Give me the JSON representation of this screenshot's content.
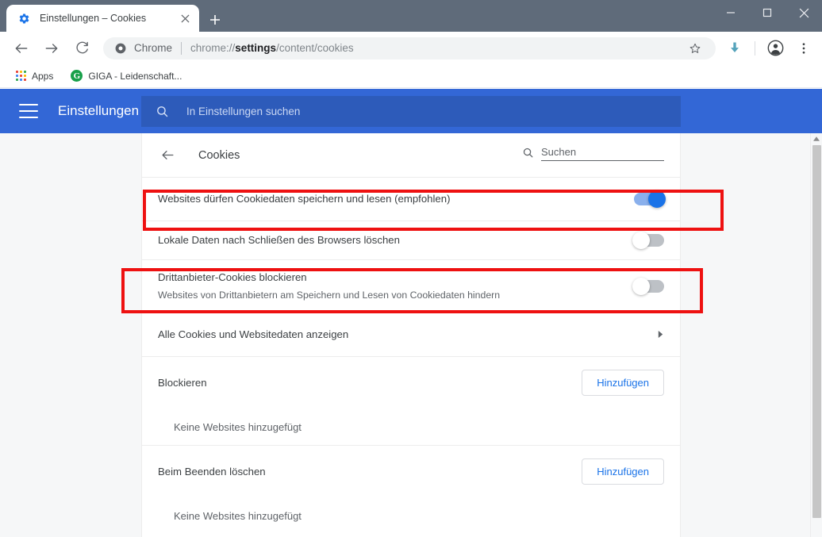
{
  "browser": {
    "tab": {
      "title": "Einstellungen – Cookies",
      "favicon": "gear-icon",
      "close_label": "✕"
    },
    "new_tab_label": "+",
    "window_controls": {
      "minimize": "–",
      "maximize": "☐",
      "close": "✕"
    },
    "toolbar": {
      "back_label": "←",
      "forward_label": "→",
      "reload_label": "⟳",
      "omnibox": {
        "scheme_label": "Chrome",
        "url_prefix": "chrome://",
        "url_bold": "settings",
        "url_suffix": "/content/cookies",
        "star_icon": "star-icon"
      },
      "download_icon": "download-arrow-icon",
      "profile_icon": "profile-avatar-icon",
      "menu_icon": "three-dot-menu-icon"
    },
    "bookmarks": [
      {
        "label": "Apps",
        "icon": "apps-grid-icon"
      },
      {
        "label": "GIGA - Leidenschaft...",
        "icon": "giga-favicon",
        "favicon_letter": "G"
      }
    ]
  },
  "settings_header": {
    "menu_icon": "hamburger-menu-icon",
    "title": "Einstellungen",
    "search": {
      "icon": "search-icon",
      "placeholder": "In Einstellungen suchen",
      "value": ""
    }
  },
  "subpage": {
    "back_icon": "back-arrow-icon",
    "title": "Cookies",
    "search": {
      "icon": "search-icon",
      "placeholder": "Suchen",
      "value": ""
    }
  },
  "rows": [
    {
      "label": "Websites dürfen Cookiedaten speichern und lesen (empfohlen)",
      "sublabel": "",
      "control": "toggle",
      "state": "on",
      "highlighted": true
    },
    {
      "label": "Lokale Daten nach Schließen des Browsers löschen",
      "sublabel": "",
      "control": "toggle",
      "state": "off",
      "highlighted": false
    },
    {
      "label": "Drittanbieter-Cookies blockieren",
      "sublabel": "Websites von Drittanbietern am Speichern und Lesen von Cookiedaten hindern",
      "control": "toggle",
      "state": "off",
      "highlighted": true
    },
    {
      "label": "Alle Cookies und Websitedaten anzeigen",
      "sublabel": "",
      "control": "chevron",
      "state": "",
      "highlighted": false
    }
  ],
  "sections": [
    {
      "title": "Blockieren",
      "add_button": "Hinzufügen",
      "empty_text": "Keine Websites hinzugefügt"
    },
    {
      "title": "Beim Beenden löschen",
      "add_button": "Hinzufügen",
      "empty_text": "Keine Websites hinzugefügt"
    }
  ],
  "scrollbar": {
    "up_arrow": "▲"
  },
  "colors": {
    "settings_header_blue": "#3367d6",
    "settings_search_blue": "#2d5bba",
    "tabstrip": "#5f6b7a",
    "accent_blue": "#1a73e8",
    "highlight_red": "#ee1111",
    "page_bg": "#f6f7f8"
  }
}
